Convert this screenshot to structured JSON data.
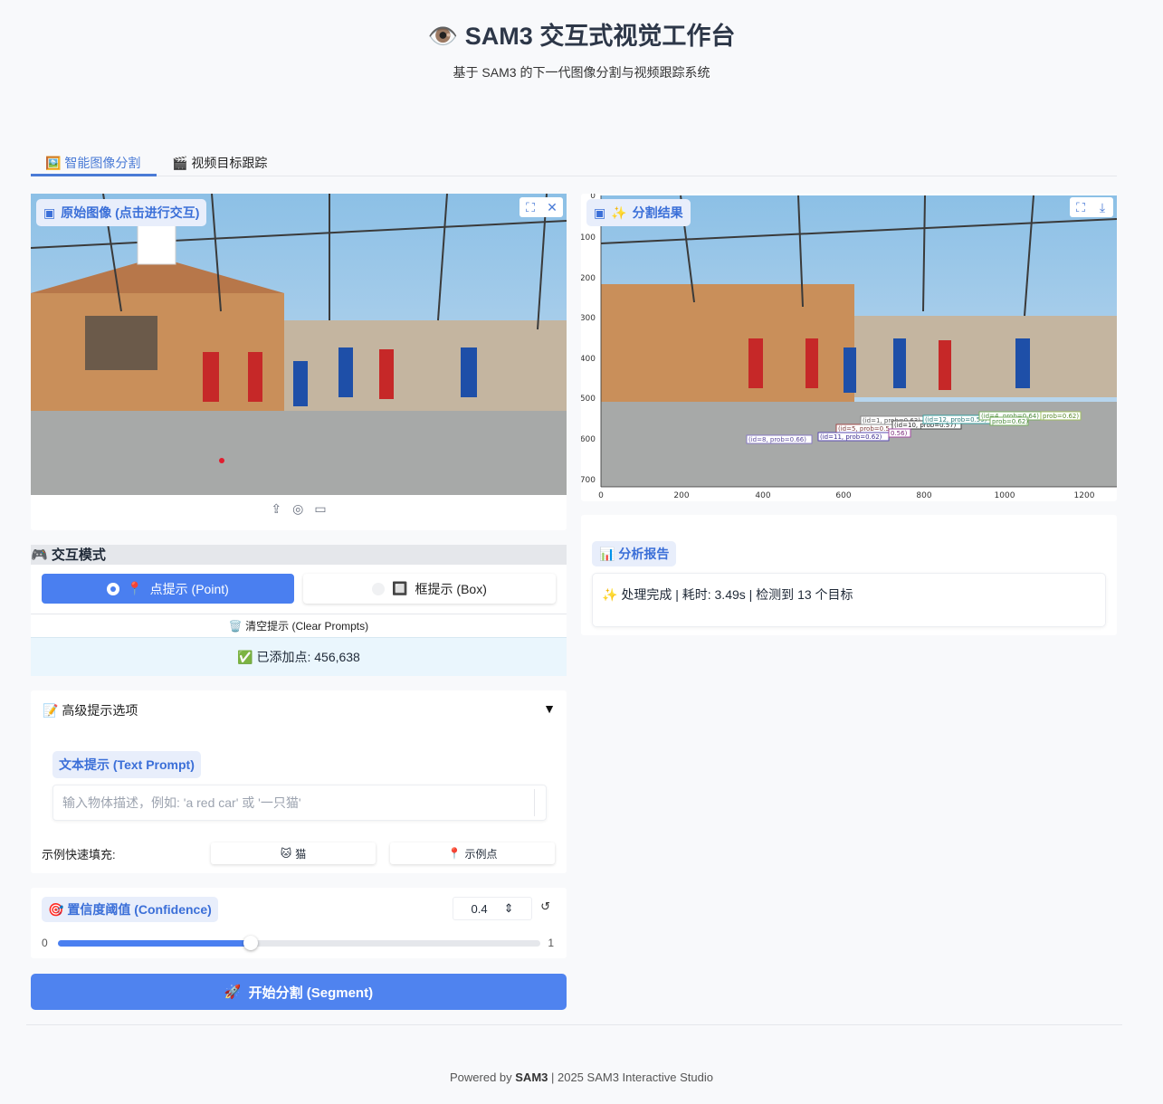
{
  "header": {
    "title_icon": "👁️",
    "title": "SAM3 交互式视觉工作台",
    "subtitle": "基于 SAM3 的下一代图像分割与视频跟踪系统"
  },
  "tabs": [
    {
      "icon": "🖼️",
      "label": "智能图像分割",
      "active": true
    },
    {
      "icon": "🎬",
      "label": "视频目标跟踪",
      "active": false
    }
  ],
  "input_image": {
    "label": "原始图像 (点击进行交互)",
    "icons": [
      "fullscreen-icon",
      "close-icon"
    ],
    "upload_icons": [
      "upload-icon",
      "webcam-icon",
      "clipboard-icon"
    ]
  },
  "result_image": {
    "label_icon": "✨",
    "label": "分割结果",
    "icons": [
      "fullscreen-icon",
      "download-icon"
    ],
    "y_ticks": [
      "0",
      "100",
      "200",
      "300",
      "400",
      "500",
      "600",
      "700"
    ],
    "x_ticks": [
      "0",
      "200",
      "400",
      "600",
      "800",
      "1000",
      "1200"
    ],
    "detections": [
      "(id=8, prob=0.66)",
      "(id=5, prob=0.5",
      "(id=1, prob=0.63)",
      "(id=10, prob=0.57)",
      "(id=12, prob=0.59)",
      "(id=11, prob=0.62)",
      "(id=4, prob=0.64)",
      "prob=0.62)",
      "prob=0.62)",
      "0.56)"
    ]
  },
  "report": {
    "chip_icon": "📊",
    "chip": "分析报告",
    "text": "✨ 处理完成 | 耗时: 3.49s | 检测到 13 个目标"
  },
  "mode": {
    "icon": "🎮",
    "title": "交互模式",
    "options": [
      {
        "icon": "📍",
        "label": "点提示 (Point)",
        "selected": true
      },
      {
        "icon": "🔲",
        "label": "框提示 (Box)",
        "selected": false
      }
    ],
    "clear_label": "🗑️ 清空提示 (Clear Prompts)",
    "status": "✅ 已添加点: 456,638"
  },
  "advanced": {
    "title": "📝 高级提示选项",
    "caret": "▼",
    "text_prompt_label": "文本提示 (Text Prompt)",
    "text_prompt_value": "",
    "text_prompt_placeholder": "输入物体描述，例如: 'a red car' 或 '一只猫'",
    "quick_label": "示例快速填充:",
    "quick_buttons": [
      {
        "icon": "🐱",
        "label": "猫"
      },
      {
        "icon": "📍",
        "label": "示例点"
      }
    ]
  },
  "confidence": {
    "icon": "🎯",
    "label": "置信度阈值 (Confidence)",
    "value": "0.4",
    "min": "0",
    "max": "1",
    "fraction": 0.4,
    "reset_icon": "↺",
    "spin_icon": "⇕"
  },
  "segment_button": {
    "icon": "🚀",
    "label": "开始分割 (Segment)"
  },
  "footer": {
    "prefix": "Powered by ",
    "brand": "SAM3",
    "suffix": " | 2025 SAM3 Interactive Studio"
  }
}
